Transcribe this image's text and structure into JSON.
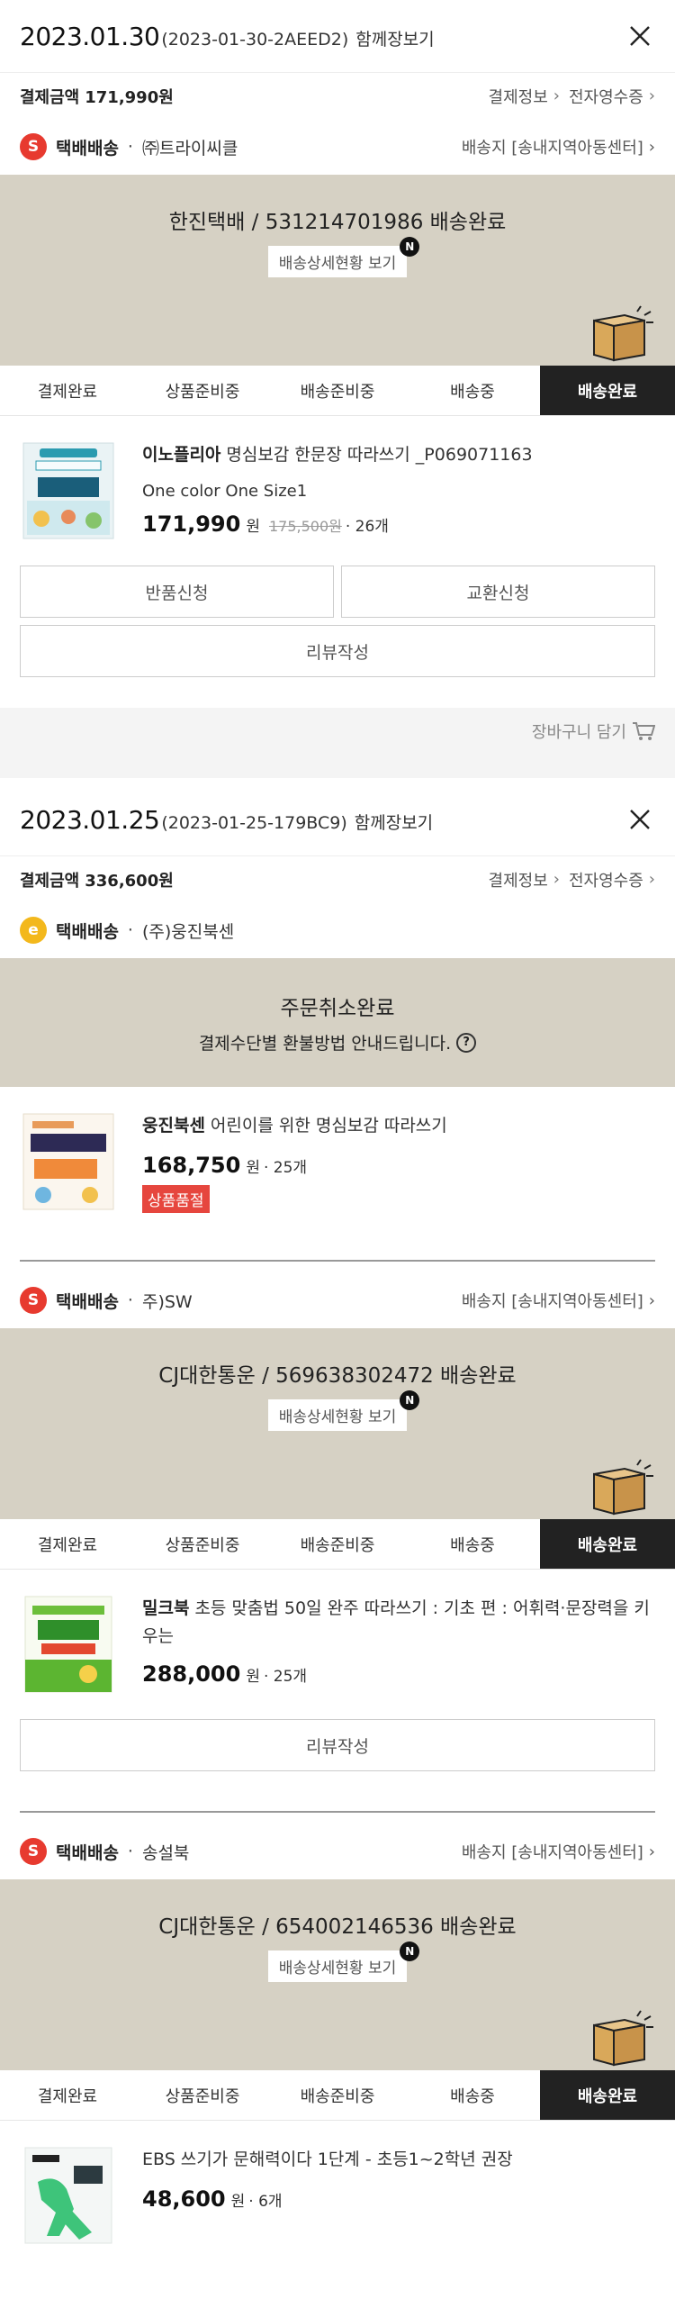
{
  "colors": {
    "status_bg": "#d6d1c4",
    "active_step": "#222222",
    "badge_s": "#e73a2f",
    "badge_e": "#f3b81c",
    "soldout": "#e6463e"
  },
  "common": {
    "together": "함께장보기",
    "pay_label": "결제금액",
    "pay_info": "결제정보",
    "receipt": "전자영수증",
    "ship_type": "택배배송",
    "dot": "·",
    "chevron": "›",
    "detail_button": "배송상세현황 보기",
    "n_badge": "N",
    "steps": [
      "결제완료",
      "상품준비중",
      "배송준비중",
      "배송중",
      "배송완료"
    ],
    "won": "원",
    "return_btn": "반품신청",
    "exchange_btn": "교환신청",
    "review_btn": "리뷰작성",
    "cart_label": "장바구니 담기",
    "badge_s": "S",
    "badge_e": "e",
    "q_mark": "?"
  },
  "order1": {
    "date": "2023.01.30",
    "code": "(2023-01-30-2AEED2)",
    "amount": "171,990원",
    "shipment1": {
      "seller": "㈜트라이씨클",
      "address": "배송지 [송내지역아동센터]",
      "carrier": "한진택배 / 531214701986 배송완료",
      "product": {
        "brand": "이노플리아",
        "name": "명심보감 한문장 따라쓰기 _P069071163",
        "option": "One color One Size1",
        "price": "171,990",
        "orig_price": "175,500원",
        "qty": "· 26개"
      }
    }
  },
  "order2": {
    "date": "2023.01.25",
    "code": "(2023-01-25-179BC9)",
    "amount": "336,600원",
    "shipment1": {
      "seller": "(주)웅진북센",
      "cancel_title": "주문취소완료",
      "refund_notice": "결제수단별 환불방법 안내드립니다.",
      "product": {
        "brand": "웅진북센",
        "name": "어린이를 위한 명심보감 따라쓰기",
        "price": "168,750",
        "qty": "· 25개",
        "soldout": "상품품절"
      }
    },
    "shipment2": {
      "seller": "주)SW",
      "address": "배송지 [송내지역아동센터]",
      "carrier": "CJ대한통운 / 569638302472 배송완료",
      "product": {
        "brand": "밀크북",
        "name": "초등 맞춤법 50일 완주 따라쓰기 : 기초 편 : 어휘력·문장력을 키우는",
        "price": "288,000",
        "qty": "· 25개"
      }
    },
    "shipment3": {
      "seller": "송설북",
      "address": "배송지 [송내지역아동센터]",
      "carrier": "CJ대한통운 / 654002146536 배송완료",
      "product": {
        "name": "EBS 쓰기가 문해력이다 1단계 - 초등1~2학년 권장",
        "price": "48,600",
        "qty": "· 6개"
      }
    }
  }
}
